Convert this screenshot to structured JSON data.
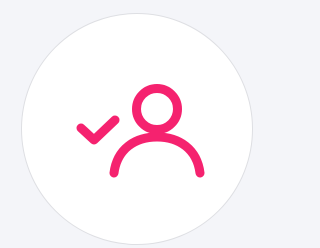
{
  "badge": {
    "icon": "user-check-icon",
    "accent_color": "#f5226f",
    "background_color": "#ffffff",
    "border_color": "#dedfe3",
    "page_background": "#f4f5f9"
  }
}
